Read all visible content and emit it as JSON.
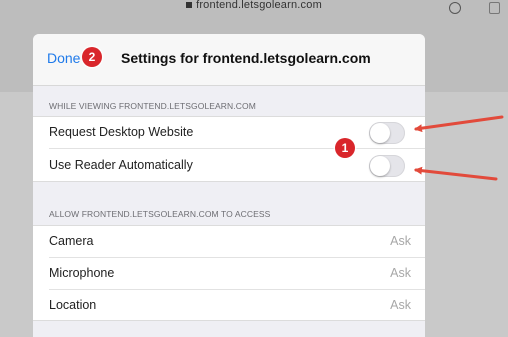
{
  "browser": {
    "url": "frontend.letsgolearn.com"
  },
  "settings": {
    "done_label": "Done",
    "title": "Settings for frontend.letsgolearn.com",
    "section1_header": "WHILE VIEWING FRONTEND.LETSGOLEARN.COM",
    "toggles": [
      {
        "label": "Request Desktop Website",
        "on": false
      },
      {
        "label": "Use Reader Automatically",
        "on": false
      }
    ],
    "section2_header": "ALLOW FRONTEND.LETSGOLEARN.COM TO ACCESS",
    "permissions": [
      {
        "label": "Camera",
        "value": "Ask"
      },
      {
        "label": "Microphone",
        "value": "Ask"
      },
      {
        "label": "Location",
        "value": "Ask"
      }
    ]
  },
  "annotations": {
    "badge_done": "2",
    "badge_toggles": "1",
    "badge_color": "#d9262b",
    "arrow_color": "#e24a3b"
  },
  "colors": {
    "accent": "#1f7aea",
    "sheet_bg": "#efeff4"
  }
}
